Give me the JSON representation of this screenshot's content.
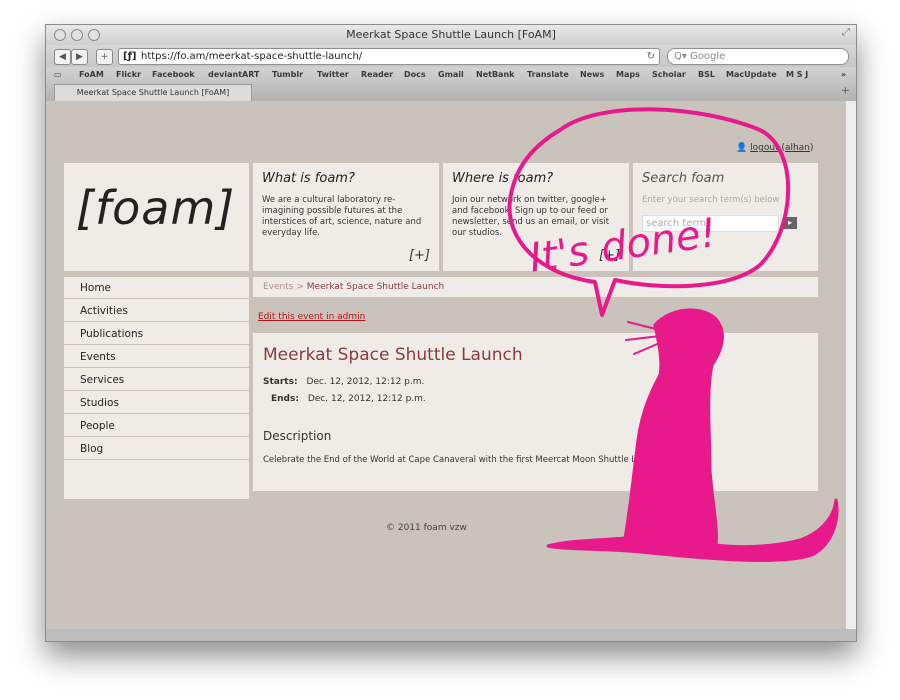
{
  "window": {
    "title": "Meerkat Space Shuttle Launch [FoAM]"
  },
  "toolbar": {
    "back_label": "◀",
    "forward_label": "▶",
    "add_label": "+",
    "url_favicon": "[ƒ]",
    "url": "https://fo.am/meerkat-space-shuttle-launch/",
    "reload_icon": "reload-icon",
    "search_placeholder": "Q▾ Google"
  },
  "bookmarks": [
    "FoAM",
    "Flickr",
    "Facebook",
    "deviantART",
    "Tumblr",
    "Twitter",
    "Reader",
    "Docs",
    "Gmail",
    "NetBank",
    "Translate",
    "News",
    "Maps",
    "Scholar",
    "BSL",
    "MacUpdate",
    "M S J"
  ],
  "tab": {
    "label": "Meerkat Space Shuttle Launch [FoAM]"
  },
  "user": {
    "logout": "logout",
    "name": "alhan"
  },
  "logo": "[foam]",
  "boxes": {
    "what": {
      "title": "What is foam?",
      "text": "We are a cultural laboratory re-imagining possible futures at the interstices of art, science, nature and everyday life.",
      "more": "[+]"
    },
    "where": {
      "title": "Where is foam?",
      "text": "Join our network on twitter, google+ and facebook. Sign up to our feed or newsletter, send us an email, or visit our studios.",
      "more": "[+]"
    },
    "search": {
      "title": "Search foam",
      "hint": "Enter your search term(s) below",
      "placeholder": "search term"
    }
  },
  "nav": [
    "Home",
    "Activities",
    "Publications",
    "Events",
    "Services",
    "Studios",
    "People",
    "Blog"
  ],
  "breadcrumb": {
    "parent": "Events",
    "separator": ">",
    "current": "Meerkat Space Shuttle Launch"
  },
  "edit_link": "Edit this event in admin",
  "event": {
    "title": "Meerkat Space Shuttle Launch",
    "starts_label": "Starts:",
    "starts": "Dec. 12, 2012, 12:12 p.m.",
    "ends_label": "Ends:",
    "ends": "Dec. 12, 2012, 12:12 p.m.",
    "description_heading": "Description",
    "description": "Celebrate the End of the World at Cape Canaveral with the first Meercat Moon Shuttle Launch!"
  },
  "footer": "© 2011 foam vzw",
  "annotation": {
    "text": "It's done!",
    "color": "#e8198b"
  }
}
